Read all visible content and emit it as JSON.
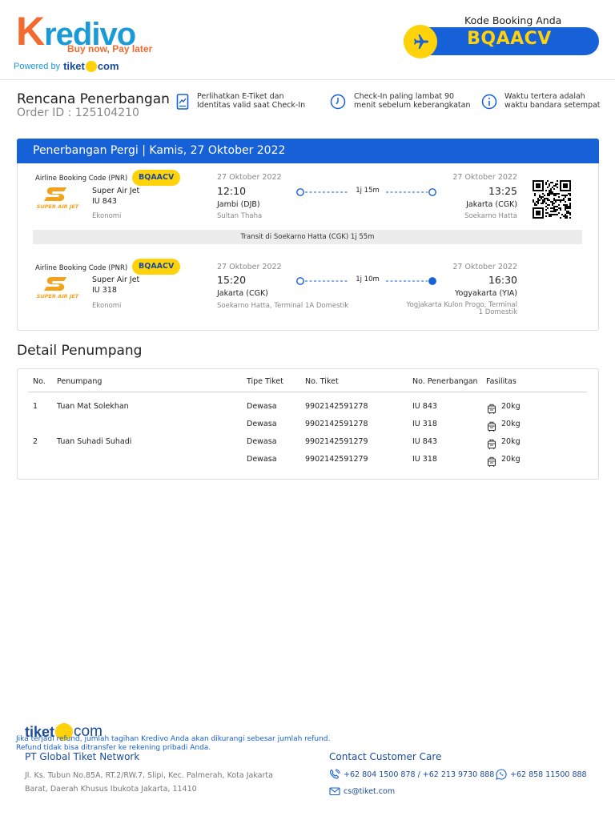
{
  "brand": {
    "logo_k": "K",
    "logo_rest": "redivo",
    "tagline": "Buy now, Pay later",
    "powered_by": "Powered by",
    "tiket_word": "tiket",
    "tiket_com": "com"
  },
  "booking": {
    "label": "Kode Booking Anda",
    "code": "BQAACV"
  },
  "plan": {
    "title": "Rencana Penerbangan",
    "order_id": "Order ID : 125104210",
    "info": [
      {
        "line1": "Perlihatkan E-Tiket dan",
        "line2": "Identitas valid saat Check-In"
      },
      {
        "line1": "Check-In paling lambat 90",
        "line2": "menit sebelum keberangkatan"
      },
      {
        "line1": "Waktu tertera adalah",
        "line2": "waktu bandara setempat"
      }
    ]
  },
  "flight": {
    "header": "Penerbangan Pergi | Kamis, 27 Oktober 2022",
    "transit": "Transit di Soekarno Hatta (CGK) 1j 55m",
    "segments": [
      {
        "pnr_label": "Airline Booking Code (PNR)",
        "pnr": "BQAACV",
        "airline": "Super Air Jet",
        "flight_no": "IU 843",
        "cabin": "Ekonomi",
        "dep_date": "27 Oktober 2022",
        "dep_time": "12:10",
        "dep_city": "Jambi (DJB)",
        "dep_airport": "Sultan Thaha",
        "duration": "1j 15m",
        "arr_date": "27 Oktober 2022",
        "arr_time": "13:25",
        "arr_city": "Jakarta (CGK)",
        "arr_airport_1": "Soekarno Hatta",
        "arr_airport_2": ""
      },
      {
        "pnr_label": "Airline Booking Code (PNR)",
        "pnr": "BQAACV",
        "airline": "Super Air Jet",
        "flight_no": "IU 318",
        "cabin": "Ekonomi",
        "dep_date": "27 Oktober 2022",
        "dep_time": "15:20",
        "dep_city": "Jakarta (CGK)",
        "dep_airport": "Soekarno Hatta, Terminal 1A Domestik",
        "duration": "1j 10m",
        "arr_date": "27 Oktober 2022",
        "arr_time": "16:30",
        "arr_city": "Yogyakarta (YIA)",
        "arr_airport_1": "Yogjakarta  Kulon  Progo,  Terminal",
        "arr_airport_2": "1  Domestik"
      }
    ]
  },
  "passengers": {
    "title": "Detail Penumpang",
    "columns": [
      "No.",
      "Penumpang",
      "Tipe Tiket",
      "No. Tiket",
      "No. Penerbangan",
      "Fasilitas"
    ],
    "rows": [
      {
        "no": "1",
        "name": "Tuan Mat Solekhan",
        "type": "Dewasa",
        "ticket": "9902142591278",
        "flight": "IU 843",
        "baggage": "20kg"
      },
      {
        "no": "",
        "name": "",
        "type": "Dewasa",
        "ticket": "9902142591278",
        "flight": "IU 318",
        "baggage": "20kg"
      },
      {
        "no": "2",
        "name": "Tuan Suhadi Suhadi",
        "type": "Dewasa",
        "ticket": "9902142591279",
        "flight": "IU 843",
        "baggage": "20kg"
      },
      {
        "no": "",
        "name": "",
        "type": "Dewasa",
        "ticket": "9902142591279",
        "flight": "IU 318",
        "baggage": "20kg"
      }
    ]
  },
  "footer": {
    "refund_1": "Jika terjadi refund, jumlah tagihan Kredivo Anda akan dikurangi sebesar jumlah refund.",
    "refund_2": "Refund tidak bisa ditransfer ke rekening pribadi Anda.",
    "company": "PT Global Tiket Network",
    "address_1": "Jl. Ks. Tubun No.85A, RT.2/RW.7, Slipi, Kec. Palmerah, Kota Jakarta",
    "address_2": "Barat, Daerah Khusus Ibukota Jakarta, 11410",
    "cc_title": "Contact Customer Care",
    "phone": "+62 804 1500 878 / +62 213 9730 888",
    "whatsapp": "+62 858 11500 888",
    "email": "cs@tiket.com"
  },
  "colors": {
    "primary_blue": "#1660d8",
    "accent_yellow": "#ffd20a",
    "kredivo_orange": "#f26a2e",
    "kredivo_blue": "#1a9ad6"
  }
}
